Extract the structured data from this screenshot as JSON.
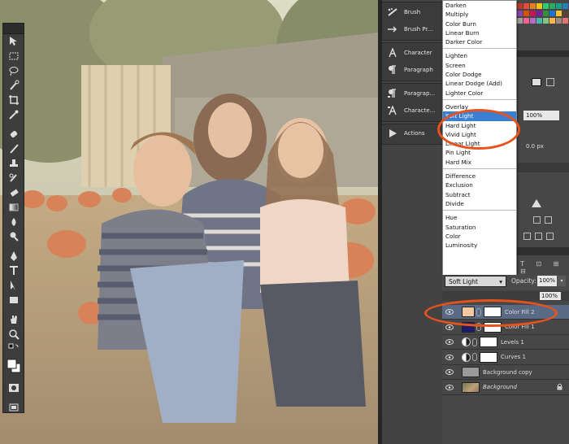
{
  "panel_col": {
    "brush": "Brush",
    "brush_presets": "Brush Pr...",
    "character": "Character",
    "paragraph": "Paragraph",
    "paragraph_styles": "Paragrap...",
    "character_styles": "Characte...",
    "actions": "Actions"
  },
  "blend_menu": {
    "groups": [
      [
        "Darken",
        "Multiply",
        "Color Burn",
        "Linear Burn",
        "Darker Color"
      ],
      [
        "Lighten",
        "Screen",
        "Color Dodge",
        "Linear Dodge (Add)",
        "Lighter Color"
      ],
      [
        "Overlay",
        "Soft Light",
        "Hard Light",
        "Vivid Light",
        "Linear Light",
        "Pin Light",
        "Hard Mix"
      ],
      [
        "Difference",
        "Exclusion",
        "Subtract",
        "Divide"
      ],
      [
        "Hue",
        "Saturation",
        "Color",
        "Luminosity"
      ]
    ],
    "selected": "Soft Light"
  },
  "right_panel": {
    "opacity_top": "100%",
    "px_value": "0.0 px"
  },
  "layers": {
    "blend_mode": "Soft Light",
    "opacity_label": "Opacity:",
    "opacity_value": "100%",
    "fill_value": "100%",
    "rows": [
      {
        "name": "Color Fill 2",
        "type": "fill",
        "color": "#f2c7a3"
      },
      {
        "name": "Color Fill 1",
        "type": "fill",
        "color": "#1c1c6e"
      },
      {
        "name": "Levels 1",
        "type": "adjust"
      },
      {
        "name": "Curves 1",
        "type": "adjust"
      },
      {
        "name": "Background copy",
        "type": "plain"
      },
      {
        "name": "Background",
        "type": "photo"
      }
    ]
  },
  "colors": {
    "accent": "#e8531d",
    "selection": "#3b7fd4"
  }
}
